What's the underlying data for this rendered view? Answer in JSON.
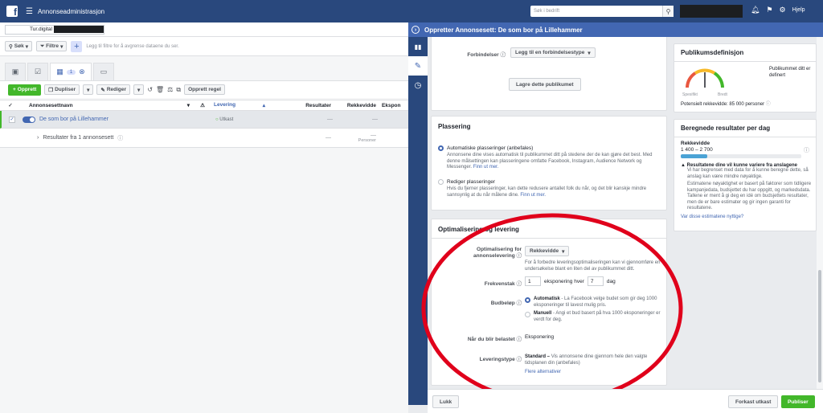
{
  "topbar": {
    "logo": "f",
    "title": "Annonseadministrasjon",
    "search_placeholder": "Søk i bedrift",
    "help": "Hjelp"
  },
  "account": {
    "name": "Tur.digital"
  },
  "filters": {
    "search": "Søk",
    "filters": "Filtre",
    "hint": "Legg til filtre for å avgrense dataene du ser."
  },
  "tabs": {
    "selected_count": "1"
  },
  "toolbar": {
    "create": "Opprett",
    "duplicate": "Dupliser",
    "edit": "Rediger",
    "create_rule": "Opprett regel"
  },
  "table": {
    "headers": [
      "Annonsesettnavn",
      "Levering",
      "Resultater",
      "Rekkevidde",
      "Ekspon"
    ],
    "row1": {
      "name": "De som bor på Lillehammer",
      "status": "Utkast",
      "results": "—",
      "reach": "—"
    },
    "row2": {
      "name": "Resultater fra 1 annonsesett",
      "results": "—",
      "reach": "—",
      "reach_sub": "Personer"
    }
  },
  "panel": {
    "title": "Oppretter Annonsesett: De som bor på Lillehammer"
  },
  "connections": {
    "label": "Forbindelser",
    "dropdown": "Legg til en forbindelsestype",
    "save_audience": "Lagre dette publikumet"
  },
  "placement": {
    "title": "Plassering",
    "auto_label": "Automatiske plasseringer (anbefales)",
    "auto_desc": "Annonsene dine vises automatisk til publikummet ditt på stedene der de kan gjøre det best. Med denne målsettingen kan plasseringene omfatte Facebook, Instagram, Audience Network og Messenger.",
    "auto_link": "Finn ut mer.",
    "edit_label": "Rediger plasseringer",
    "edit_desc": "Hvis du fjerner plasseringer, kan dette redusere antallet folk du når, og det blir kanskje mindre sannsynlig at du når målene dine.",
    "edit_link": "Finn ut mer."
  },
  "optimization": {
    "title": "Optimalisering og levering",
    "opt_label": "Optimalisering for annonselevering",
    "opt_value": "Rekkevidde",
    "opt_help": "For å forbedre leveringsoptimaliseringen kan vi gjennomføre en undersøkelse blant en liten del av publikummet ditt.",
    "freq_label": "Frekvenstak",
    "freq_n": "1",
    "freq_mid": "eksponering hver",
    "freq_days": "7",
    "freq_unit": "dag",
    "bid_label": "Budbeløp",
    "bid_auto": "Automatisk",
    "bid_auto_desc": "- La Facebook velge budet som gir deg 1000 eksponeringer til lavest mulig pris.",
    "bid_manual": "Manuell",
    "bid_manual_desc": "- Angi et bud basert på hva 1000 eksponeringer er verdt for deg.",
    "charge_label": "Når du blir belastet",
    "charge_value": "Eksponering",
    "delivery_label": "Leveringstype",
    "delivery_value": "Standard –",
    "delivery_desc": "Vis annonsene dine gjennom hele den valgte tidsplanen din (anbefales)",
    "more": "Flere alternativer"
  },
  "audience": {
    "title": "Publikumsdefinisjon",
    "desc": "Publikummet ditt er definert",
    "specific": "Spesifikt",
    "broad": "Bredt",
    "reach": "Potensielt rekkevidde: 85 000 personer"
  },
  "estimate": {
    "title": "Beregnede resultater per dag",
    "label": "Rekkevidde",
    "range": "1 400 – 2 700",
    "fill_percent": 22,
    "warn_title": "Resultatene dine vil kunne variere fra anslagene",
    "warn_body": "Vi har begrenset med data for å kunne beregne dette, så anslag kan være mindre nøyaktige.",
    "note": "Estimatene nøyaktighet er basert på faktorer som tidligere kampanjedata, budsjettet du har oppgitt, og markedsdata. Tallene er ment å gi deg en idé om budsjettets resultater, men de er bare estimater og gir ingen garanti for resultatene.",
    "link": "Var disse estimatene nyttige?"
  },
  "footer": {
    "close": "Lukk",
    "discard": "Forkast utkast",
    "publish": "Publiser"
  }
}
